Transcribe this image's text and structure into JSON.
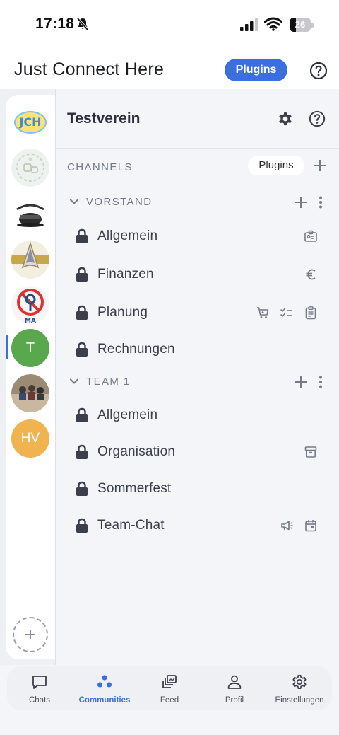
{
  "status_bar": {
    "time": "17:18",
    "battery": "26"
  },
  "header": {
    "title": "Just Connect Here",
    "plugins_label": "Plugins"
  },
  "rail": {
    "avatars": [
      {
        "initials": "JCH",
        "color": "#6bb3e8"
      },
      {
        "initials": "",
        "color": "#e9eef0"
      },
      {
        "initials": "",
        "color": "#ffffff"
      },
      {
        "initials": "",
        "color": "#c8a64a"
      },
      {
        "initials": "",
        "color": "#f1f1f1"
      },
      {
        "initials": "T",
        "color": "#5aa84e"
      },
      {
        "initials": "",
        "color": "#8a7a66"
      },
      {
        "initials": "HV",
        "color": "#f0b34f"
      }
    ]
  },
  "community": {
    "name": "Testverein"
  },
  "channels": {
    "section_label": "CHANNELS",
    "plugins_label": "Plugins",
    "groups": [
      {
        "name": "VORSTAND",
        "items": [
          {
            "name": "Allgemein",
            "icons": [
              "id-card-icon"
            ]
          },
          {
            "name": "Finanzen",
            "icons": [
              "euro-icon"
            ]
          },
          {
            "name": "Planung",
            "icons": [
              "cart-icon",
              "checklist-icon",
              "clipboard-icon"
            ]
          },
          {
            "name": "Rechnungen",
            "icons": []
          }
        ]
      },
      {
        "name": "TEAM 1",
        "items": [
          {
            "name": "Allgemein",
            "icons": []
          },
          {
            "name": "Organisation",
            "icons": [
              "archive-icon"
            ]
          },
          {
            "name": "Sommerfest",
            "icons": []
          },
          {
            "name": "Team-Chat",
            "icons": [
              "megaphone-icon",
              "calendar-icon"
            ]
          }
        ]
      }
    ]
  },
  "tabbar": {
    "tabs": [
      {
        "label": "Chats",
        "icon": "chat-icon",
        "active": false
      },
      {
        "label": "Communities",
        "icon": "communities-icon",
        "active": true
      },
      {
        "label": "Feed",
        "icon": "feed-icon",
        "active": false
      },
      {
        "label": "Profil",
        "icon": "person-icon",
        "active": false
      },
      {
        "label": "Einstellungen",
        "icon": "gear-icon",
        "active": false
      }
    ]
  },
  "colors": {
    "accent": "#3b6fe0",
    "text": "#2b2f3a",
    "muted": "#737a88",
    "background": "#f4f5f8"
  }
}
